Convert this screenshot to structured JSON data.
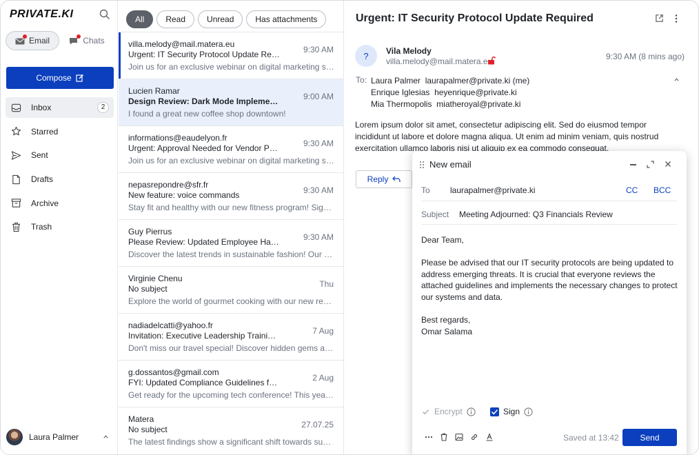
{
  "app": {
    "logo": "PRIVATE.KI"
  },
  "sidebar": {
    "tabs": {
      "email": "Email",
      "chats": "Chats"
    },
    "compose_label": "Compose",
    "items": [
      {
        "label": "Inbox",
        "badge": "2",
        "icon": "inbox-icon"
      },
      {
        "label": "Starred",
        "icon": "star-icon"
      },
      {
        "label": "Sent",
        "icon": "send-icon"
      },
      {
        "label": "Drafts",
        "icon": "draft-icon"
      },
      {
        "label": "Archive",
        "icon": "archive-icon"
      },
      {
        "label": "Trash",
        "icon": "trash-icon"
      }
    ],
    "user": {
      "name": "Laura Palmer"
    }
  },
  "filters": [
    "All",
    "Read",
    "Unread",
    "Has attachments"
  ],
  "messages": [
    {
      "from": "villa.melody@mail.matera.eu",
      "subject": "Urgent: IT Security Protocol Update Required",
      "preview": "Join us for an exclusive webinar on digital marketing strategies",
      "time": "9:30 AM"
    },
    {
      "from": "Lucien Ramar",
      "subject": "Design Review: Dark Mode Implementation",
      "preview": "I found a great new coffee shop downtown!",
      "time": "9:00 AM"
    },
    {
      "from": "informations@eaudelyon.fr",
      "subject": "Urgent: Approval Needed for Vendor Payment",
      "preview": "Join us for an exclusive webinar on digital marketing strategies",
      "time": "9:30 AM"
    },
    {
      "from": "nepasrepondre@sfr.fr",
      "subject": "New feature: voice commands",
      "preview": "Stay fit and healthy with our new fitness program! Sign up today",
      "time": "9:30 AM"
    },
    {
      "from": "Guy Pierrus",
      "subject": "Please Review: Updated Employee Handbook",
      "preview": "Discover the latest trends in sustainable fashion! Our new collection",
      "time": "9:30 AM"
    },
    {
      "from": "Virginie Chenu",
      "subject": "No subject",
      "preview": "Explore the world of gourmet cooking with our new recipe series",
      "time": "Thu"
    },
    {
      "from": "nadiadelcatti@yahoo.fr",
      "subject": "Invitation: Executive Leadership Training - Details",
      "preview": "Don't miss our travel special! Discover hidden gems around the world",
      "time": "7 Aug"
    },
    {
      "from": "g.dossantos@gmail.com",
      "subject": "FYI: Updated Compliance Guidelines for 2025",
      "preview": "Get ready for the upcoming tech conference! This year, we'll feature",
      "time": "2 Aug"
    },
    {
      "from": "Matera",
      "subject": "No subject",
      "preview": "The latest findings show a significant shift towards sustainable energy",
      "time": "27.07.25"
    }
  ],
  "reader": {
    "title": "Urgent: IT Security Protocol Update Required",
    "avatar_initial": "?",
    "sender_name": "Vila Melody",
    "sender_email": "villa.melody@mail.matera.eu",
    "time": "9:30 AM (8 mins ago)",
    "to_label": "To:",
    "recipients": [
      {
        "name": "Laura Palmer",
        "email": "laurapalmer@private.ki (me)"
      },
      {
        "name": "Enrique Iglesias",
        "email": "heyenrique@private.ki"
      },
      {
        "name": "Mia Thermopolis",
        "email": "miatheroyal@private.ki"
      }
    ],
    "body": "Lorem ipsum dolor sit amet, consectetur adipiscing elit. Sed do eiusmod tempor incididunt ut labore et dolore magna aliqua. Ut enim ad minim veniam, quis nostrud exercitation ullamco laboris nisi ut aliquip ex ea commodo consequat.",
    "reply_label": "Reply"
  },
  "compose": {
    "title": "New email",
    "to_label": "To",
    "to_value": "laurapalmer@private.ki",
    "cc_label": "CC",
    "bcc_label": "BCC",
    "subject_label": "Subject",
    "subject_value": "Meeting Adjourned: Q3 Financials Review",
    "body": [
      "Dear Team,",
      "Please be advised that our IT security protocols are being updated to address emerging threats. It is crucial that everyone reviews the attached guidelines and implements the necessary changes to protect our systems and data.",
      "Best regards,\nOmar Salama"
    ],
    "encrypt_label": "Encrypt",
    "sign_label": "Sign",
    "saved_text": "Saved at 13:42",
    "send_label": "Send"
  },
  "colors": {
    "accent": "#0b3fbe",
    "selected_row": "#eaf0fb",
    "notification": "#e0202b"
  }
}
